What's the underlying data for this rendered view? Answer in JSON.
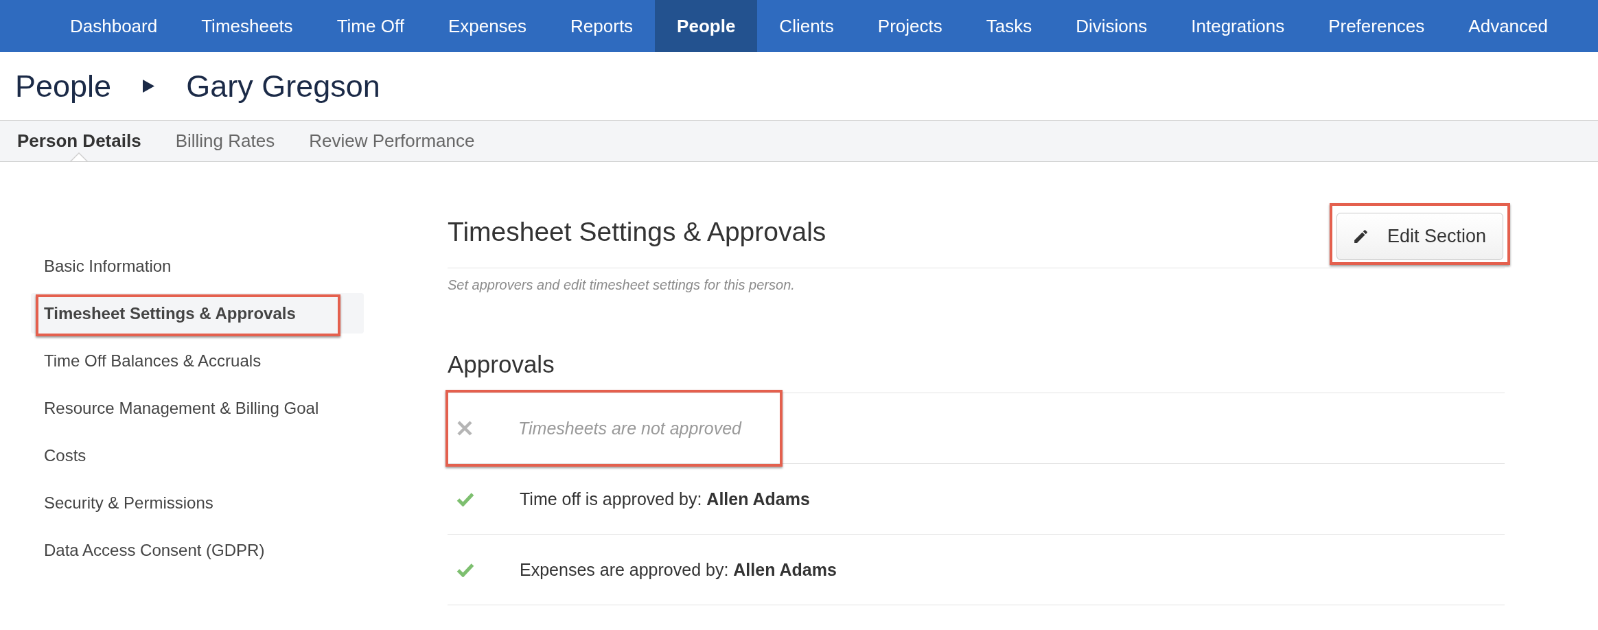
{
  "nav": {
    "items": [
      {
        "label": "Dashboard",
        "selected": false
      },
      {
        "label": "Timesheets",
        "selected": false
      },
      {
        "label": "Time Off",
        "selected": false
      },
      {
        "label": "Expenses",
        "selected": false
      },
      {
        "label": "Reports",
        "selected": false
      },
      {
        "label": "People",
        "selected": true
      },
      {
        "label": "Clients",
        "selected": false
      },
      {
        "label": "Projects",
        "selected": false
      },
      {
        "label": "Tasks",
        "selected": false
      },
      {
        "label": "Divisions",
        "selected": false
      },
      {
        "label": "Integrations",
        "selected": false
      },
      {
        "label": "Preferences",
        "selected": false
      },
      {
        "label": "Advanced",
        "selected": false
      }
    ]
  },
  "breadcrumb": {
    "parent": "People",
    "current": "Gary Gregson"
  },
  "subtabs": [
    {
      "label": "Person Details",
      "selected": true
    },
    {
      "label": "Billing Rates",
      "selected": false
    },
    {
      "label": "Review Performance",
      "selected": false
    }
  ],
  "sidebar": {
    "items": [
      {
        "label": "Basic Information",
        "selected": false,
        "annotated": false
      },
      {
        "label": "Timesheet Settings & Approvals",
        "selected": true,
        "annotated": true
      },
      {
        "label": "Time Off Balances & Accruals",
        "selected": false,
        "annotated": false
      },
      {
        "label": "Resource Management & Billing Goal",
        "selected": false,
        "annotated": false
      },
      {
        "label": "Costs",
        "selected": false,
        "annotated": false
      },
      {
        "label": "Security & Permissions",
        "selected": false,
        "annotated": false
      },
      {
        "label": "Data Access Consent (GDPR)",
        "selected": false,
        "annotated": false
      }
    ]
  },
  "section": {
    "title": "Timesheet Settings & Approvals",
    "description": "Set approvers and edit timesheet settings for this person.",
    "edit_button": {
      "label": "Edit Section",
      "annotated": true
    }
  },
  "approvals": {
    "title": "Approvals",
    "rows": [
      {
        "text": "Timesheets are not approved",
        "approved": false,
        "annotated": true
      },
      {
        "text": "Time off is approved by: **Allen Adams**",
        "approved": true,
        "annotated": false
      },
      {
        "text": "Expenses are approved by: **Allen Adams**",
        "approved": true,
        "annotated": false
      }
    ]
  }
}
